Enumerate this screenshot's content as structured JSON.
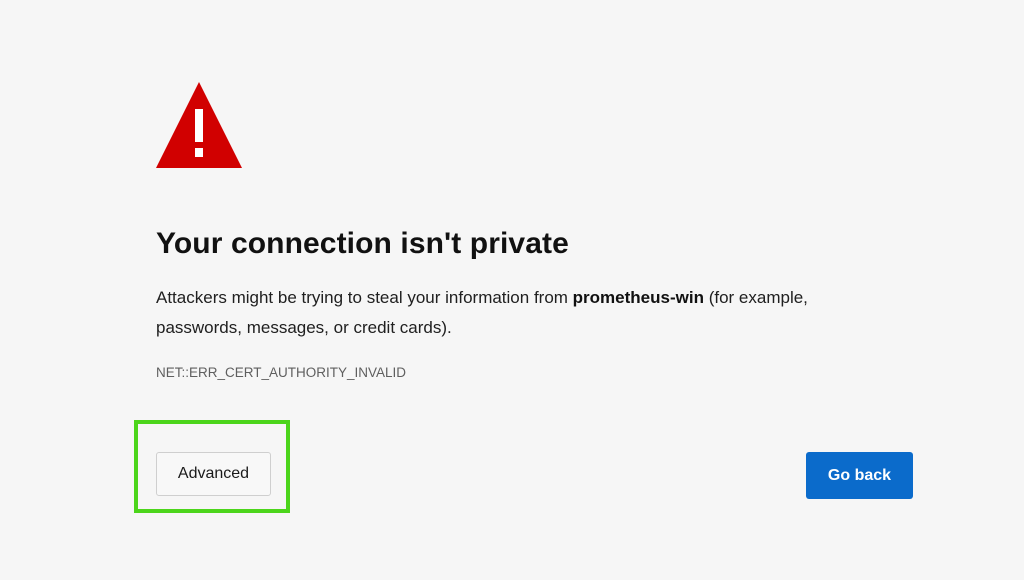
{
  "colors": {
    "background": "#f6f6f6",
    "warning_red": "#d10000",
    "primary_blue": "#0b6bcb",
    "highlight_green": "#4cd51b"
  },
  "icon": {
    "name": "warning-triangle-icon"
  },
  "title": "Your connection isn't private",
  "message": {
    "before": "Attackers might be trying to steal your information from ",
    "host": "prometheus-win",
    "after": " (for example, passwords, messages, or credit cards)."
  },
  "error_code": "NET::ERR_CERT_AUTHORITY_INVALID",
  "buttons": {
    "advanced": "Advanced",
    "go_back": "Go back"
  }
}
